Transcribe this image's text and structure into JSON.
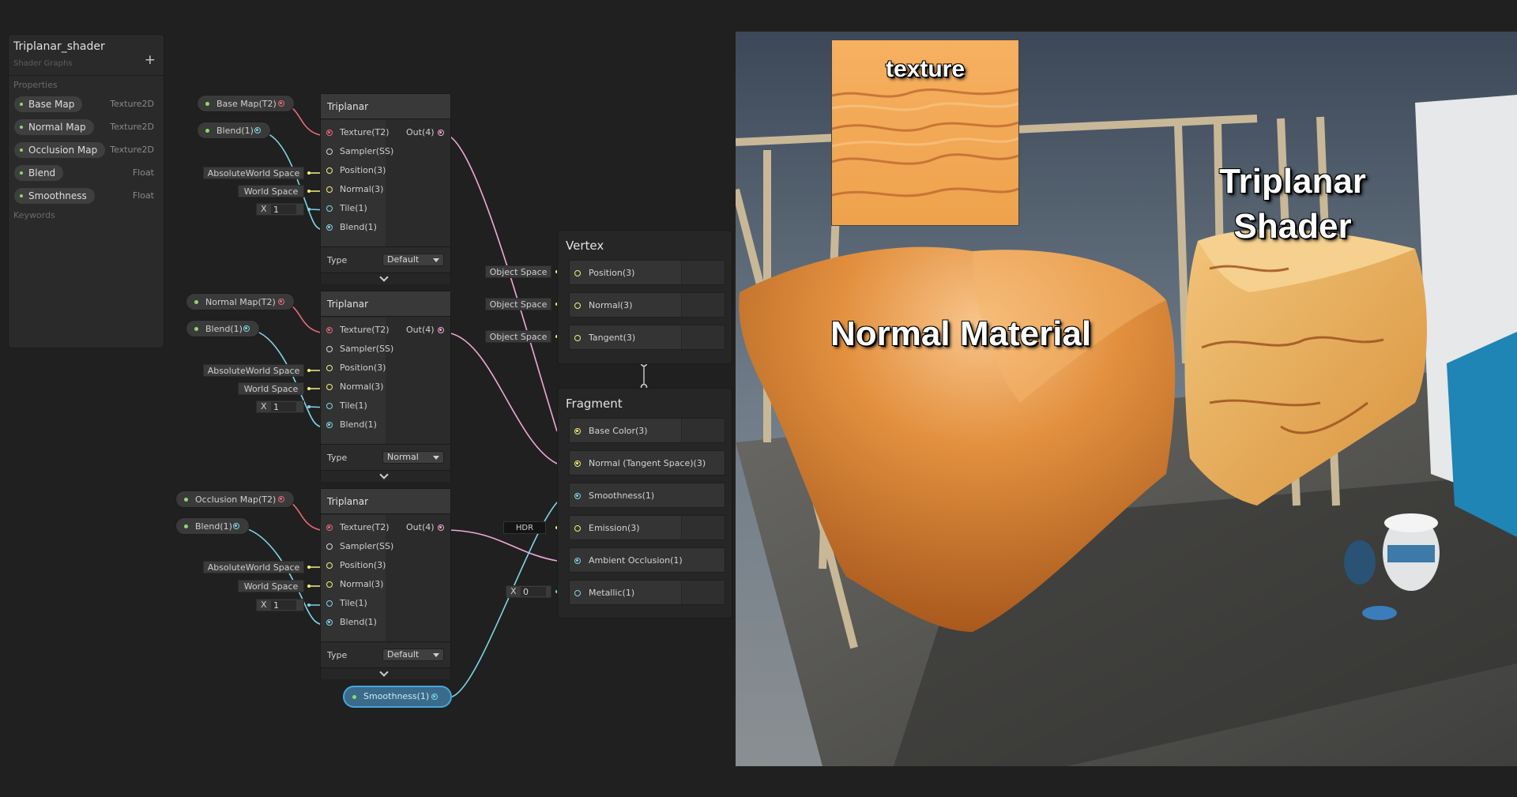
{
  "blackboard": {
    "title": "Triplanar_shader",
    "subtitle": "Shader Graphs",
    "add_icon": "+",
    "properties_label": "Properties",
    "keywords_label": "Keywords",
    "properties": [
      {
        "name": "Base Map",
        "type": "Texture2D"
      },
      {
        "name": "Normal Map",
        "type": "Texture2D"
      },
      {
        "name": "Occlusion Map",
        "type": "Texture2D"
      },
      {
        "name": "Blend",
        "type": "Float"
      },
      {
        "name": "Smoothness",
        "type": "Float"
      }
    ]
  },
  "graph": {
    "pills": {
      "base_map": "Base Map(T2)",
      "normal_map": "Normal Map(T2)",
      "occlusion_map": "Occlusion Map(T2)",
      "blend": "Blend(1)",
      "smoothness": "Smoothness(1)"
    },
    "defaults": {
      "absolute_world_space": "AbsoluteWorld Space",
      "world_space": "World Space",
      "x_label": "X",
      "tile_value": "1"
    },
    "triplanar_nodes": [
      {
        "title": "Triplanar",
        "type_value": "Default"
      },
      {
        "title": "Triplanar",
        "type_value": "Normal"
      },
      {
        "title": "Triplanar",
        "type_value": "Default"
      }
    ],
    "node_ports": {
      "texture": "Texture(T2)",
      "sampler": "Sampler(SS)",
      "position": "Position(3)",
      "normal": "Normal(3)",
      "tile": "Tile(1)",
      "blend": "Blend(1)",
      "out": "Out(4)",
      "type_label": "Type"
    },
    "vertex": {
      "title": "Vertex",
      "blocks": [
        "Position(3)",
        "Normal(3)",
        "Tangent(3)"
      ],
      "space_label": "Object Space"
    },
    "fragment": {
      "title": "Fragment",
      "blocks": [
        "Base Color(3)",
        "Normal (Tangent Space)(3)",
        "Smoothness(1)",
        "Emission(3)",
        "Ambient Occlusion(1)",
        "Metallic(1)"
      ],
      "hdr_label": "HDR",
      "metallic_x_label": "X",
      "metallic_value": "0"
    }
  },
  "viewport": {
    "texture_label": "texture",
    "normal_label": "Normal Material",
    "triplanar_label_1": "Triplanar",
    "triplanar_label_2": "Shader"
  },
  "colors": {
    "texture_port": "#e86a7a",
    "vector_port": "#f5f07a",
    "float_port": "#7fd6e8",
    "out_port": "#f2a8d8",
    "property_dot": "#8ed96e",
    "selection": "#44a6dc"
  }
}
